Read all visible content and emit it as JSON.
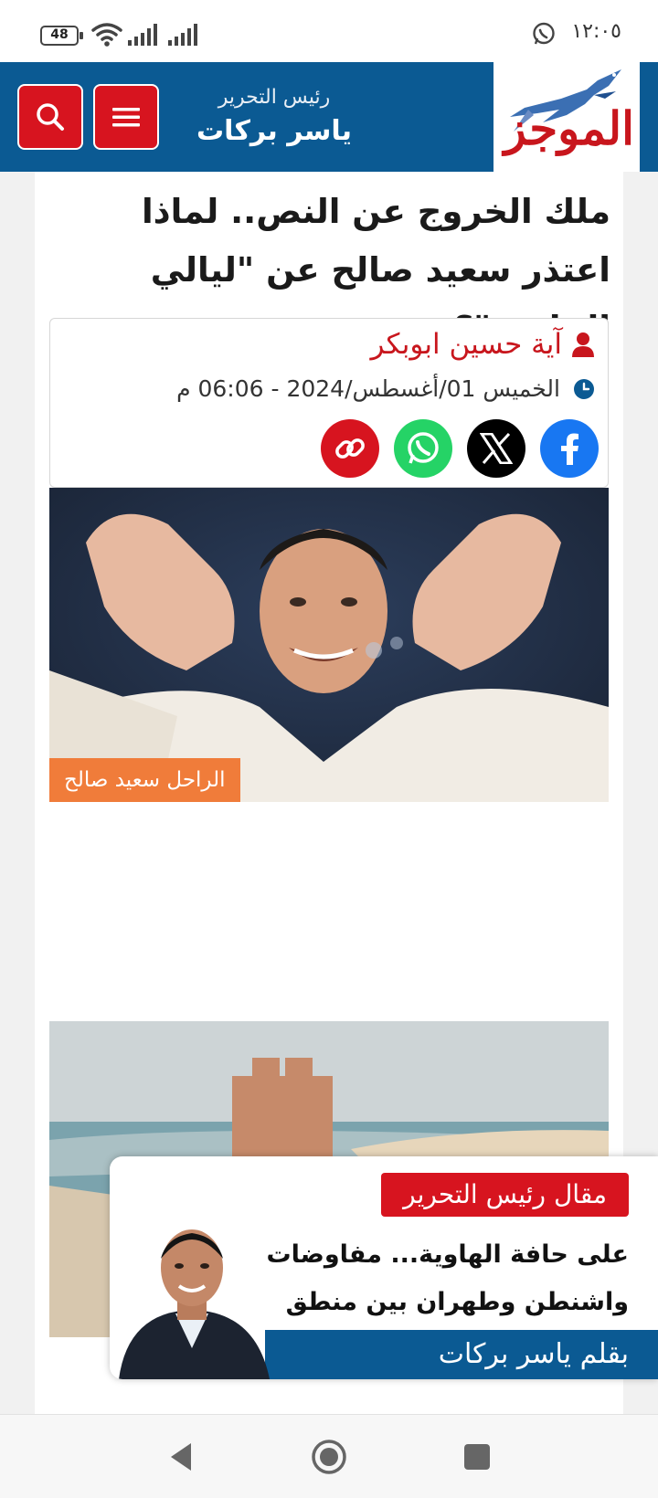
{
  "status_bar": {
    "time": "١٢:٠٥",
    "battery": "48",
    "icons": [
      "whatsapp-icon",
      "wifi-icon",
      "signal-icon",
      "signal-icon"
    ]
  },
  "header": {
    "logo_text": "الموجز",
    "chief_label": "رئيس التحرير",
    "chief_name": "ياسر بركات",
    "icons": [
      "search-icon",
      "menu-icon"
    ]
  },
  "article": {
    "headline": "ملك الخروج عن النص.. لماذا اعتذر سعيد صالح عن \"ليالي الحلمية\"؟",
    "author": "آية حسين ابوبكر",
    "date": "الخميس 01/أغسطس/2024 - 06:06 م",
    "share_icons": [
      "facebook-icon",
      "x-icon",
      "whatsapp-icon",
      "link-icon"
    ],
    "photo_caption": "الراحل سعيد صالح"
  },
  "editor_widget": {
    "badge": "مقال رئيس التحرير",
    "title": "على حافة الهاوية... مفاوضات واشنطن وطهران بين منطق",
    "byline": "بقلم ياسر بركات"
  },
  "nav_bar": {
    "icons": [
      "back-icon",
      "home-icon",
      "recents-icon"
    ]
  },
  "colors": {
    "brand_blue": "#0b5a93",
    "brand_red": "#d7141f",
    "caption_orange": "#f07c3a",
    "facebook": "#1877f2",
    "whatsapp": "#25d366",
    "x": "#000000",
    "link": "#d7141f"
  }
}
